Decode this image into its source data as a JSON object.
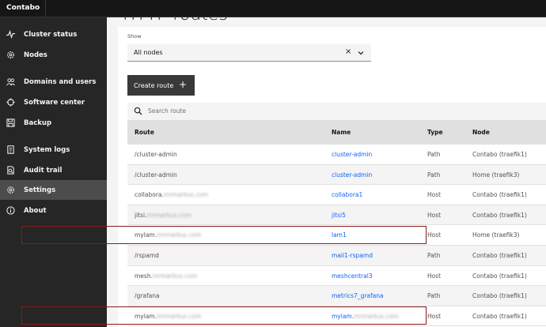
{
  "app": {
    "brand": "Contabo"
  },
  "sidebar": {
    "items": [
      {
        "label": "Cluster status",
        "icon": "activity-icon"
      },
      {
        "label": "Nodes",
        "icon": "gear-icon"
      },
      {
        "label": "Domains and users",
        "icon": "users-icon"
      },
      {
        "label": "Software center",
        "icon": "package-icon"
      },
      {
        "label": "Backup",
        "icon": "save-icon"
      },
      {
        "label": "System logs",
        "icon": "document-icon"
      },
      {
        "label": "Audit trail",
        "icon": "audit-icon"
      },
      {
        "label": "Settings",
        "icon": "gear-icon"
      },
      {
        "label": "About",
        "icon": "info-icon"
      }
    ],
    "active": "Settings"
  },
  "main": {
    "page_title": "HTTP routes",
    "filter": {
      "label": "Show",
      "value": "All nodes",
      "clear": "×"
    },
    "create_button": {
      "label": "Create route",
      "icon": "+"
    },
    "search": {
      "placeholder": "Search route"
    },
    "table": {
      "columns": [
        "Route",
        "Name",
        "Type",
        "Node"
      ],
      "rows": [
        {
          "route": "/cluster-admin",
          "route_blur": "",
          "name": "cluster-admin",
          "name_blur": "",
          "type": "Path",
          "node": "Contabo (traefik1)"
        },
        {
          "route": "/cluster-admin",
          "route_blur": "",
          "name": "cluster-admin",
          "name_blur": "",
          "type": "Path",
          "node": "Home (traefik3)"
        },
        {
          "route": "collabora.",
          "route_blur": "mrmarkus.com",
          "name": "collabora1",
          "name_blur": "",
          "type": "Host",
          "node": "Contabo (traefik1)"
        },
        {
          "route": "jitsi.",
          "route_blur": "mrmarkus.com",
          "name": "jitsi5",
          "name_blur": "",
          "type": "Host",
          "node": "Contabo (traefik1)"
        },
        {
          "route": "mylam.",
          "route_blur": "mrmarkus.com",
          "name": "lam1",
          "name_blur": "",
          "type": "Host",
          "node": "Home (traefik3)"
        },
        {
          "route": "/rspamd",
          "route_blur": "",
          "name": "mail1-rspamd",
          "name_blur": "",
          "type": "Path",
          "node": "Contabo (traefik1)"
        },
        {
          "route": "mesh.",
          "route_blur": "mrmarkus.com",
          "name": "meshcentral3",
          "name_blur": "",
          "type": "Host",
          "node": "Contabo (traefik1)"
        },
        {
          "route": "/grafana",
          "route_blur": "",
          "name": "metrics7_grafana",
          "name_blur": "",
          "type": "Path",
          "node": "Contabo (traefik1)"
        },
        {
          "route": "mylam.",
          "route_blur": "mrmarkus.com",
          "name": "mylam.",
          "name_blur": "mrmarkus.com",
          "type": "Host",
          "node": "Contabo (traefik1)"
        }
      ]
    }
  },
  "colors": {
    "sidebar": "#262626",
    "topbar": "#161616",
    "link": "#0f62fe",
    "highlight": "#8b1a1a"
  }
}
